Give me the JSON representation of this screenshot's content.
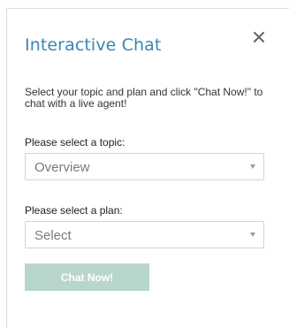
{
  "dialog": {
    "title": "Interactive Chat",
    "close_icon": "close-icon",
    "intro": "Select your topic and plan and click \"Chat Now!\" to chat with a live agent!"
  },
  "topic": {
    "label": "Please select a topic:",
    "selected": "Overview"
  },
  "plan": {
    "label": "Please select a plan:",
    "selected": "Select"
  },
  "chat_button": {
    "label": "Chat Now!"
  },
  "colors": {
    "title": "#3c84b8",
    "button_disabled": "#b8d6cc"
  }
}
